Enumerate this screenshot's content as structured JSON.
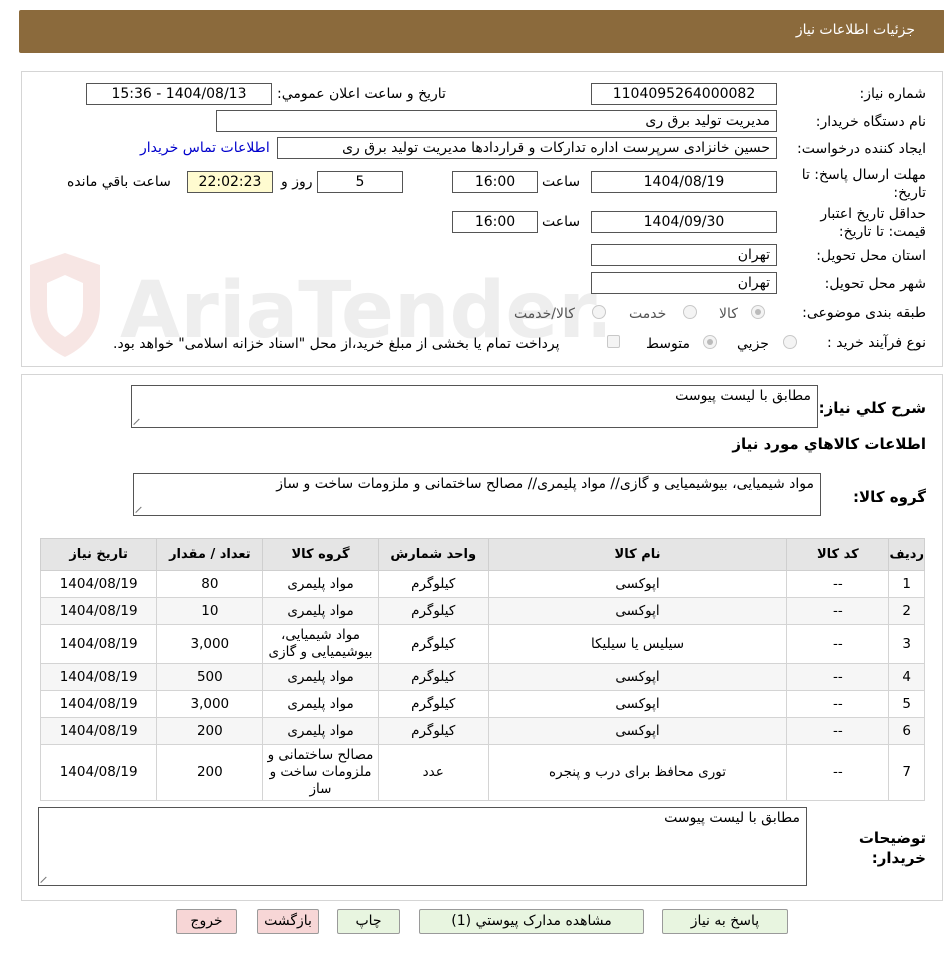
{
  "header": {
    "title": "جزئیات اطلاعات نیاز"
  },
  "form": {
    "need_number_label": "شماره نیاز:",
    "need_number": "1104095264000082",
    "announce_label": "تاریخ و ساعت اعلان عمومي:",
    "announce_value": "1404/08/13 - 15:36",
    "buyer_org_label": "نام دستگاه خریدار:",
    "buyer_org": "مدیریت تولید برق ری",
    "requester_label": "ایجاد کننده درخواست:",
    "requester": "حسین خانزادی سرپرست اداره تدارکات و قراردادها مدیریت تولید برق ری",
    "contact_link": "اطلاعات تماس خریدار",
    "deadline_label": "مهلت ارسال پاسخ: تا تاریخ:",
    "deadline_date": "1404/08/19",
    "time_label": "ساعت",
    "deadline_time": "16:00",
    "days": "5",
    "days_label": "روز و",
    "remaining": "22:02:23",
    "remaining_label": "ساعت باقي مانده",
    "validity_label": "حداقل تاریخ اعتبار قیمت: تا تاریخ:",
    "validity_date": "1404/09/30",
    "validity_time": "16:00",
    "province_label": "استان محل تحویل:",
    "province": "تهران",
    "city_label": "شهر محل تحویل:",
    "city": "تهران",
    "category_label": "طبقه بندی موضوعی:",
    "category_options": [
      "کالا",
      "خدمت",
      "کالا/خدمت"
    ],
    "process_label": "نوع فرآیند خرید :",
    "process_options": [
      "جزیي",
      "متوسط"
    ],
    "payment_note": "پرداخت تمام یا بخشی از مبلغ خرید،از محل \"اسناد خزانه اسلامی\" خواهد بود."
  },
  "details": {
    "summary_label": "شرح کلي نیاز:",
    "summary": "مطابق با لیست پیوست",
    "goods_info_title": "اطلاعات کالاهاي مورد نیاز",
    "goods_group_label": "گروه کالا:",
    "goods_group": "مواد شیمیایی، بیوشیمیایی و  گازی// مواد پلیمری// مصالح ساختمانی و ملزومات ساخت و ساز",
    "buyer_notes_label": "توضیحات خریدار:",
    "buyer_notes": "مطابق با لیست پیوست"
  },
  "table": {
    "headers": [
      "ردیف",
      "کد کالا",
      "نام کالا",
      "واحد شمارش",
      "گروه کالا",
      "تعداد / مقدار",
      "تاریخ نیاز"
    ],
    "rows": [
      [
        "1",
        "--",
        "اپوکسی",
        "کیلوگرم",
        "مواد پلیمری",
        "80",
        "1404/08/19"
      ],
      [
        "2",
        "--",
        "اپوکسی",
        "کیلوگرم",
        "مواد پلیمری",
        "10",
        "1404/08/19"
      ],
      [
        "3",
        "--",
        "سیلیس یا سیلیکا",
        "کیلوگرم",
        "مواد شیمیایی، بیوشیمیایی و گازی",
        "3,000",
        "1404/08/19"
      ],
      [
        "4",
        "--",
        "اپوکسی",
        "کیلوگرم",
        "مواد پلیمری",
        "500",
        "1404/08/19"
      ],
      [
        "5",
        "--",
        "اپوکسی",
        "کیلوگرم",
        "مواد پلیمری",
        "3,000",
        "1404/08/19"
      ],
      [
        "6",
        "--",
        "اپوکسی",
        "کیلوگرم",
        "مواد پلیمری",
        "200",
        "1404/08/19"
      ],
      [
        "7",
        "--",
        "توری محافظ برای درب و پنجره",
        "عدد",
        "مصالح ساختمانی و ملزومات ساخت و ساز",
        "200",
        "1404/08/19"
      ]
    ]
  },
  "buttons": {
    "reply": "پاسخ به نیاز",
    "attachments": "مشاهده مدارک پیوستي (1)",
    "print": "چاپ",
    "back": "بازگشت",
    "exit": "خروج"
  },
  "watermark": {
    "text": "AriaTender.neT"
  }
}
